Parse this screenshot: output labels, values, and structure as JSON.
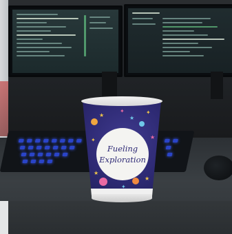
{
  "cup": {
    "label_line_1": "Fueling",
    "label_line_2": "Exploration",
    "design_colors": {
      "cup_base": "#2e2a74",
      "badge": "#f4f4f1",
      "stars": "#f0c64a",
      "accent_pink": "#ea6aa3",
      "accent_blue": "#6fc7e8"
    }
  },
  "keyboard": {
    "backlight_color": "#2a44c8"
  },
  "icons": [
    "star-icon",
    "planet-icon",
    "rocket-icon"
  ]
}
